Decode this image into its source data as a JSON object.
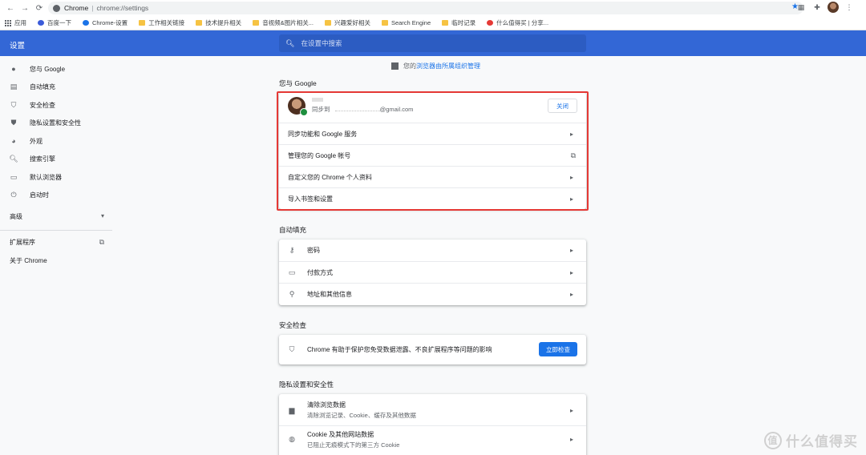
{
  "browser": {
    "tab_site": "Chrome",
    "url": "chrome://settings",
    "bookmarks": [
      {
        "label": "应用",
        "icon": "apps-grid-icon"
      },
      {
        "label": "百度一下",
        "icon": "baidu-paw-icon"
      },
      {
        "label": "Chrome-设置",
        "icon": "gear-icon"
      },
      {
        "label": "工作相关链接",
        "icon": "folder-icon"
      },
      {
        "label": "技术提升相关",
        "icon": "folder-icon"
      },
      {
        "label": "音视频&图片相关...",
        "icon": "folder-icon"
      },
      {
        "label": "兴趣爱好相关",
        "icon": "folder-icon"
      },
      {
        "label": "Search Engine",
        "icon": "folder-icon"
      },
      {
        "label": "临时记录",
        "icon": "folder-icon"
      },
      {
        "label": "什么值得买 | 分享...",
        "icon": "smzdm-icon"
      }
    ]
  },
  "header": {
    "title": "设置",
    "search_placeholder": "在设置中搜索"
  },
  "sidebar": {
    "items": [
      {
        "label": "您与 Google",
        "icon": "person-icon"
      },
      {
        "label": "自动填充",
        "icon": "clipboard-icon"
      },
      {
        "label": "安全检查",
        "icon": "shield-check-icon"
      },
      {
        "label": "隐私设置和安全性",
        "icon": "shield-icon"
      },
      {
        "label": "外观",
        "icon": "palette-icon"
      },
      {
        "label": "搜索引擎",
        "icon": "search-icon"
      },
      {
        "label": "默认浏览器",
        "icon": "browser-icon"
      },
      {
        "label": "启动时",
        "icon": "power-icon"
      }
    ],
    "advanced": "高级",
    "extensions": "扩展程序",
    "about": "关于 Chrome"
  },
  "main": {
    "managed_prefix": "您的",
    "managed_link": "浏览器由所属组织管理",
    "you_google": {
      "title": "您与 Google",
      "sync_prefix": "同步到",
      "sync_email": "@gmail.com",
      "close_button": "关闭",
      "rows": [
        {
          "label": "同步功能和 Google 服务"
        },
        {
          "label": "管理您的 Google 帐号"
        },
        {
          "label": "自定义您的 Chrome 个人资料"
        },
        {
          "label": "导入书签和设置"
        }
      ]
    },
    "autofill": {
      "title": "自动填充",
      "rows": [
        {
          "label": "密码",
          "icon": "key-icon"
        },
        {
          "label": "付款方式",
          "icon": "credit-card-icon"
        },
        {
          "label": "地址和其他信息",
          "icon": "location-pin-icon"
        }
      ]
    },
    "safety": {
      "title": "安全检查",
      "text": "Chrome 有助于保护您免受数据泄露、不良扩展程序等问题的影响",
      "button": "立即检查"
    },
    "privacy": {
      "title": "隐私设置和安全性",
      "rows": [
        {
          "label": "清除浏览数据",
          "sub": "清除浏览记录、Cookie、缓存及其他数据"
        },
        {
          "label": "Cookie 及其他网站数据",
          "sub": "已阻止无痕模式下的第三方 Cookie"
        }
      ]
    }
  },
  "watermark": "什么值得买",
  "colors": {
    "header_blue": "#3367d6",
    "accent": "#1a73e8",
    "highlight_red": "#e53935"
  }
}
